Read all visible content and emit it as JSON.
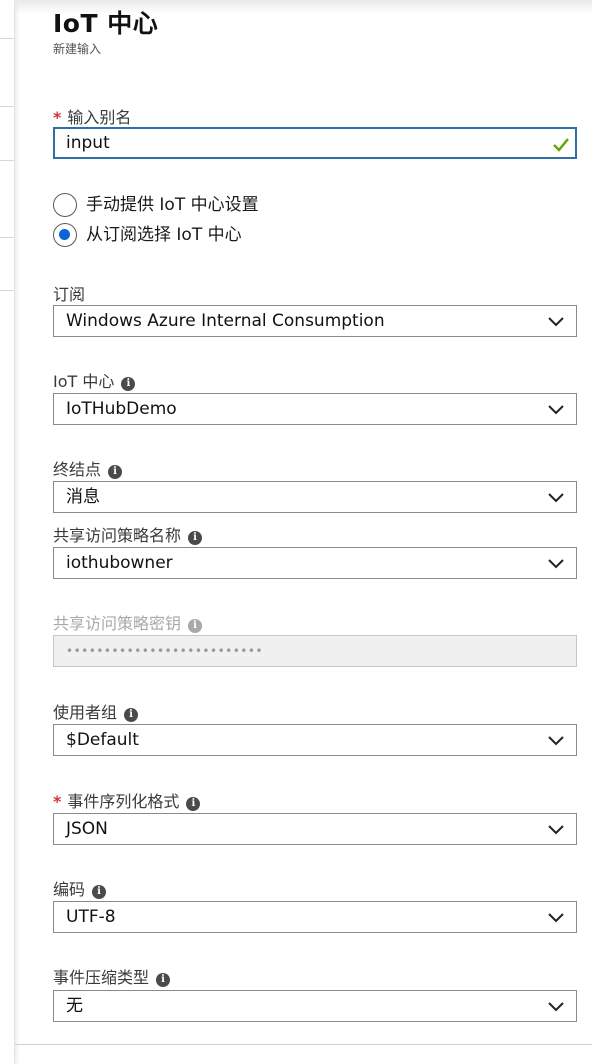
{
  "header": {
    "title": "IoT 中心",
    "subtitle": "新建输入"
  },
  "alias": {
    "label": "输入别名",
    "required_mark": "*",
    "value": "input"
  },
  "source_options": [
    {
      "label": "手动提供 IoT 中心设置",
      "selected": false
    },
    {
      "label": "从订阅选择 IoT 中心",
      "selected": true
    }
  ],
  "subscription": {
    "label": "订阅",
    "value": "Windows Azure Internal Consumption"
  },
  "iot_hub": {
    "label": "IoT 中心",
    "value": "IoTHubDemo"
  },
  "endpoint": {
    "label": "终结点",
    "value": "消息"
  },
  "policy_name": {
    "label": "共享访问策略名称",
    "value": "iothubowner"
  },
  "policy_key": {
    "label": "共享访问策略密钥",
    "value": "••••••••••••••••••••••••••"
  },
  "consumer_group": {
    "label": "使用者组",
    "value": "$Default"
  },
  "serialization": {
    "label": "事件序列化格式",
    "required_mark": "*",
    "value": "JSON"
  },
  "encoding": {
    "label": "编码",
    "value": "UTF-8"
  },
  "compression": {
    "label": "事件压缩类型",
    "value": "无"
  },
  "icons": {
    "info": "i"
  },
  "colors": {
    "focus_border": "#2f6fa8",
    "check": "#5ea500",
    "radio_selected": "#0b63d6",
    "required": "#d13438"
  }
}
